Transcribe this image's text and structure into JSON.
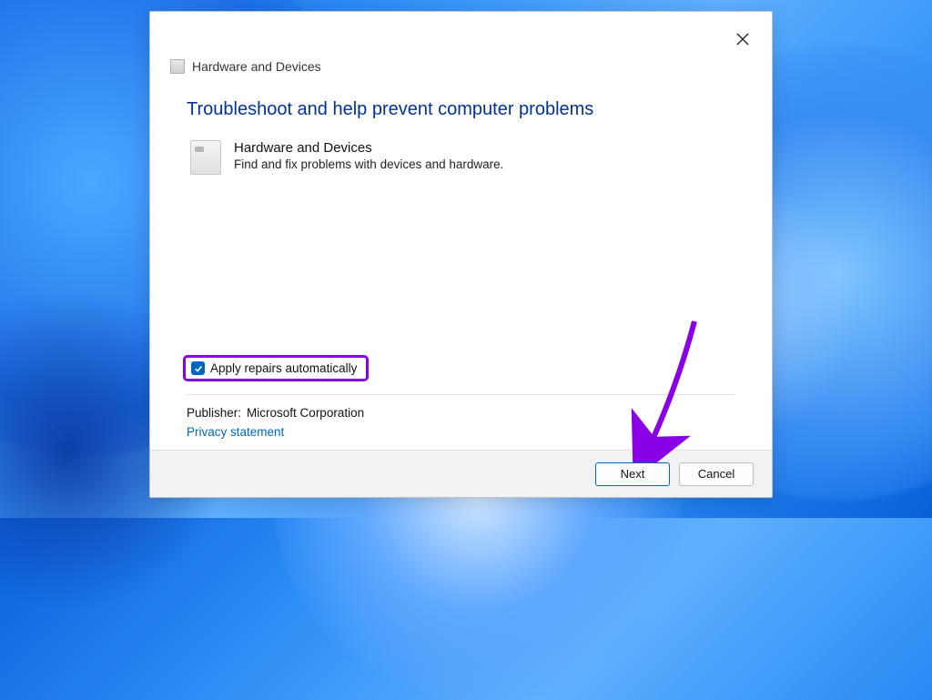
{
  "window": {
    "title": "Hardware and Devices",
    "heading": "Troubleshoot and help prevent computer problems",
    "troubleshooter": {
      "name": "Hardware and Devices",
      "description": "Find and fix problems with devices and hardware."
    },
    "checkbox": {
      "label": "Apply repairs automatically",
      "checked": true
    },
    "publisher": {
      "label": "Publisher:",
      "value": "Microsoft Corporation"
    },
    "privacy_link": "Privacy statement",
    "buttons": {
      "next": "Next",
      "cancel": "Cancel"
    }
  },
  "annotation": {
    "highlight_color": "#8a00e6"
  }
}
